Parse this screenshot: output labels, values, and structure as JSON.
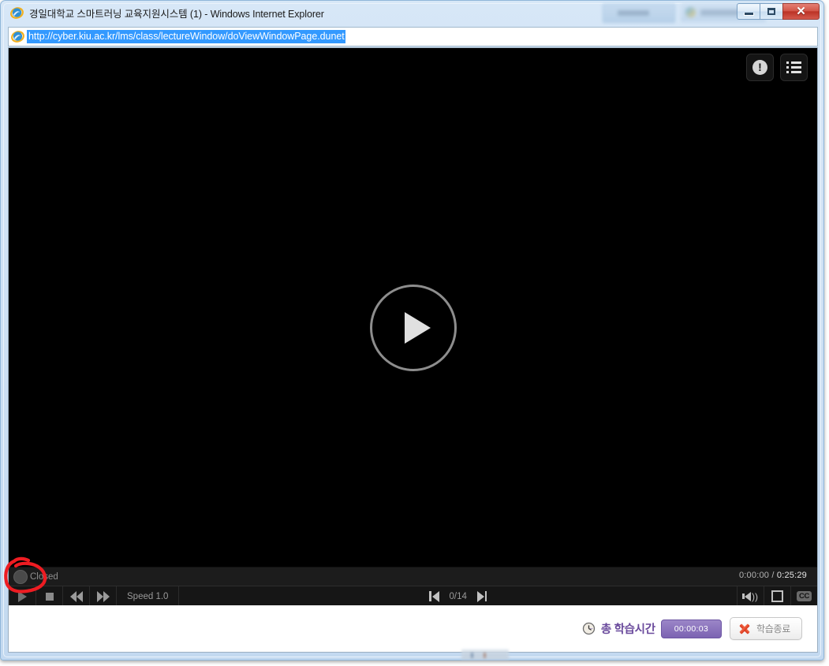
{
  "window": {
    "title": "경일대학교 스마트러닝 교육지원시스템 (1) - Windows Internet Explorer",
    "minimize_label": "",
    "maximize_label": "",
    "close_label": "✕"
  },
  "address_bar": {
    "url": "http://cyber.kiu.ac.kr/lms/class/lectureWindow/doViewWindowPage.dunet",
    "icon": "ie-icon"
  },
  "player": {
    "top_icons": [
      {
        "name": "alert-icon",
        "glyph": "!"
      },
      {
        "name": "playlist-icon",
        "glyph": "≡"
      }
    ],
    "play_button_label": "▶",
    "caption_toggle": {
      "label": "Closed",
      "state": "off"
    },
    "time": {
      "current": "0:00:00",
      "separator": "/",
      "total": "0:25:29"
    },
    "controls": {
      "play_label": "",
      "stop_label": "",
      "rewind_label": "",
      "forward_label": "",
      "speed_label": "Speed 1.0"
    },
    "navigation": {
      "prev_label": "",
      "page_indicator": "0/14",
      "next_label": ""
    },
    "right_controls": {
      "volume_label": "",
      "fullscreen_label": "",
      "cc_label": "CC"
    }
  },
  "status_bar": {
    "study_time_label": "총 학습시간",
    "study_time_value": "00:00:03",
    "end_button_label": "학습종료"
  },
  "colors": {
    "accent_purple": "#6a4a9c",
    "badge_purple": "#8b74bd",
    "annotation_red": "#ee1c22",
    "url_highlight": "#3399ff"
  }
}
